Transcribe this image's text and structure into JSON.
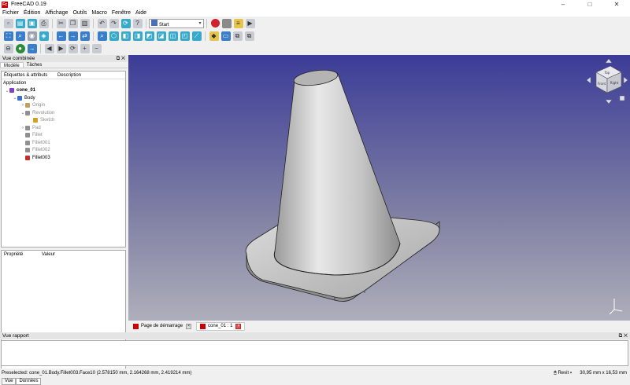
{
  "window": {
    "title": "FreeCAD 0.19",
    "logo": "Fc",
    "min": "–",
    "max": "□",
    "close": "✕"
  },
  "menu": [
    "Fichier",
    "Édition",
    "Affichage",
    "Outils",
    "Macro",
    "Fenêtre",
    "Aide"
  ],
  "toolbar": {
    "workbench": "Start"
  },
  "combo_view": {
    "title": "Vue combinée",
    "tabs": [
      "Modèle",
      "Tâches"
    ],
    "columns": [
      "Étiquettes & attributs",
      "Description"
    ],
    "tree_root": "Application",
    "items": [
      {
        "label": "cone_01",
        "depth": 0,
        "expand": "⌄",
        "color": "#8040c0",
        "dim": false
      },
      {
        "label": "Body",
        "depth": 1,
        "expand": "⌄",
        "color": "#3a6ec9",
        "dim": false
      },
      {
        "label": "Origin",
        "depth": 2,
        "expand": "›",
        "color": "#c0a060",
        "dim": true
      },
      {
        "label": "Revolution",
        "depth": 2,
        "expand": "⌄",
        "color": "#909090",
        "dim": true
      },
      {
        "label": "Sketch",
        "depth": 3,
        "expand": "",
        "color": "#d0a020",
        "dim": true
      },
      {
        "label": "Pad",
        "depth": 2,
        "expand": "›",
        "color": "#909090",
        "dim": true
      },
      {
        "label": "Fillet",
        "depth": 2,
        "expand": "",
        "color": "#909090",
        "dim": true
      },
      {
        "label": "Fillet001",
        "depth": 2,
        "expand": "",
        "color": "#909090",
        "dim": true
      },
      {
        "label": "Fillet002",
        "depth": 2,
        "expand": "",
        "color": "#909090",
        "dim": true
      },
      {
        "label": "Fillet003",
        "depth": 2,
        "expand": "",
        "color": "#c03030",
        "dim": false
      }
    ],
    "prop_columns": [
      "Propriété",
      "Valeur"
    ],
    "bottom_tabs": [
      "Vue",
      "Données"
    ]
  },
  "doc_tabs": [
    {
      "label": "Page de démarrage",
      "active": false
    },
    {
      "label": "cone_01 : 1",
      "active": true
    }
  ],
  "navcube": {
    "top": "Top",
    "front": "Front",
    "right": "Right"
  },
  "report": {
    "title": "Vue rapport"
  },
  "status": {
    "text": "Preselected: cone_01.Body.Fillet003.Face10 (2.578150 mm, 2.164268 mm, 2.419214 mm)",
    "nav_style": "Revit",
    "dimensions": "30,95 mm x 16,53 mm"
  }
}
